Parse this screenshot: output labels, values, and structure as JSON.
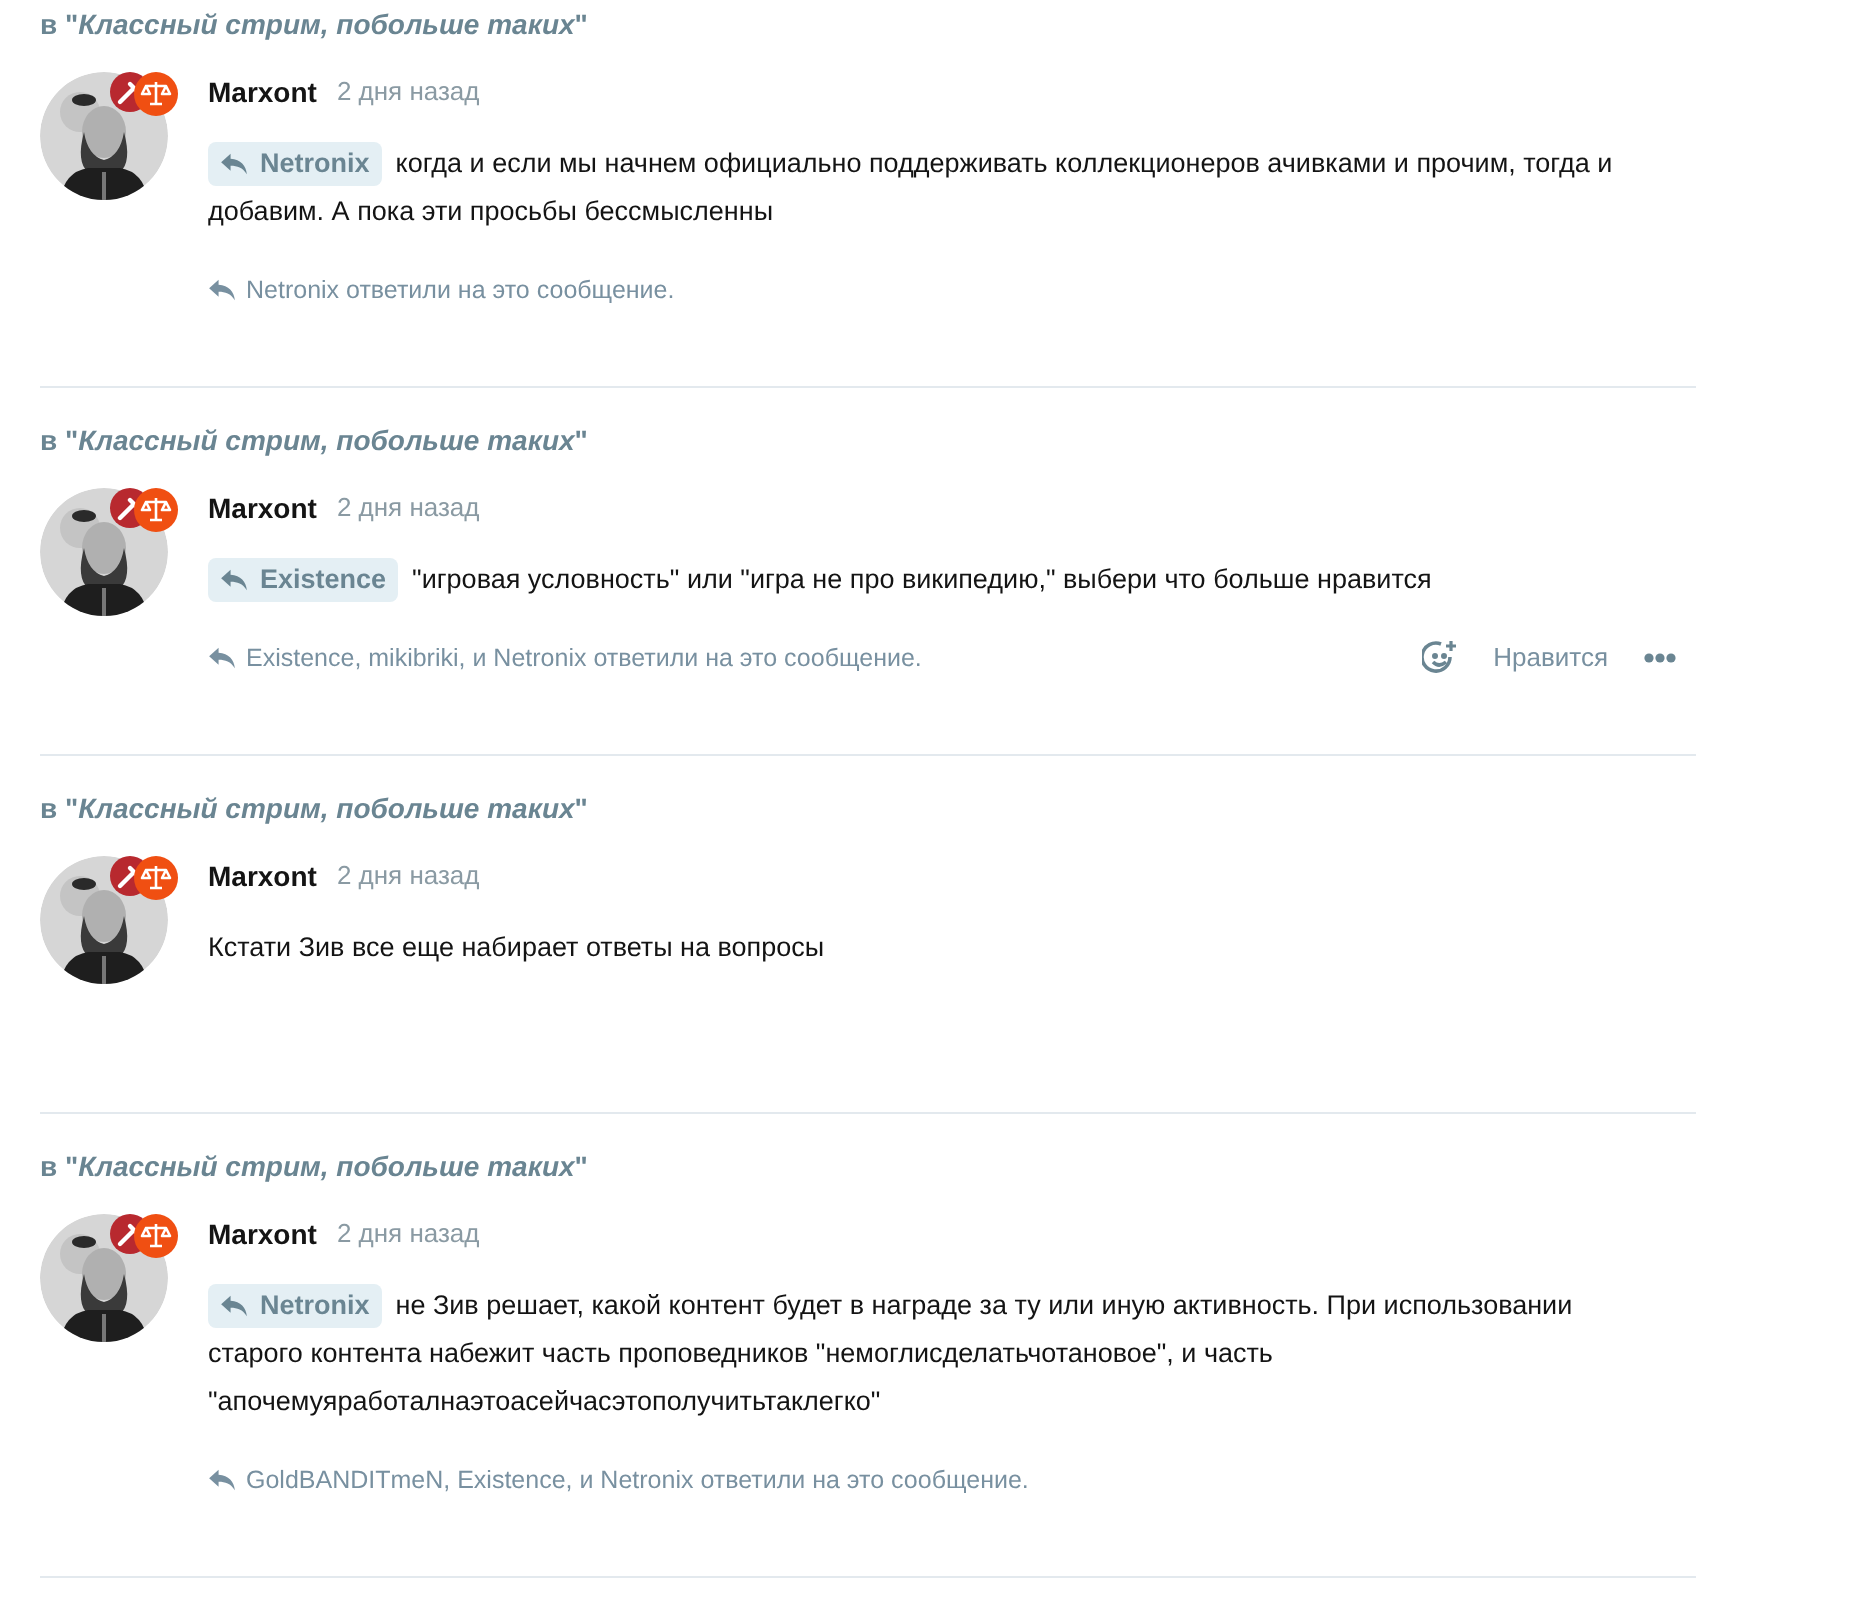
{
  "posts": [
    {
      "topic": "в \"*Классный стрим, побольше таких*\"",
      "author": "Marxont",
      "time": "2 дня назад",
      "quote": "Netronix",
      "body": "когда и если мы начнем официально поддерживать коллекционеров ачивками и прочим, тогда и добавим. А пока эти просьбы бессмысленны",
      "replies": "Netronix ответили на это сообщение."
    },
    {
      "topic": "в \"*Классный стрим, побольше таких*\"",
      "author": "Marxont",
      "time": "2 дня назад",
      "quote": "Existence",
      "body": "\"игровая условность\" или \"игра не про википедию,\" выбери что больше нравится",
      "replies": "Existence, mikibriki, и Netronix ответили на это сообщение.",
      "like_label": "Нравится"
    },
    {
      "topic": "в \"*Классный стрим, побольше таких*\"",
      "author": "Marxont",
      "time": "2 дня назад",
      "body": "Кстати Зив все еще набирает ответы на вопросы"
    },
    {
      "topic": "в \"*Классный стрим, побольше таких*\"",
      "author": "Marxont",
      "time": "2 дня назад",
      "quote": "Netronix",
      "body": "не Зив решает, какой контент будет в награде за ту или иную активность. При использовании старого контента набежит часть проповедников \"немоглисделатьчотановое\", и часть \"апочемуяработалнаэтоасейчасэтополучитьтаклегко\"",
      "replies": "GoldBANDITmeN, Existence, и Netronix ответили на это сообщение."
    }
  ]
}
